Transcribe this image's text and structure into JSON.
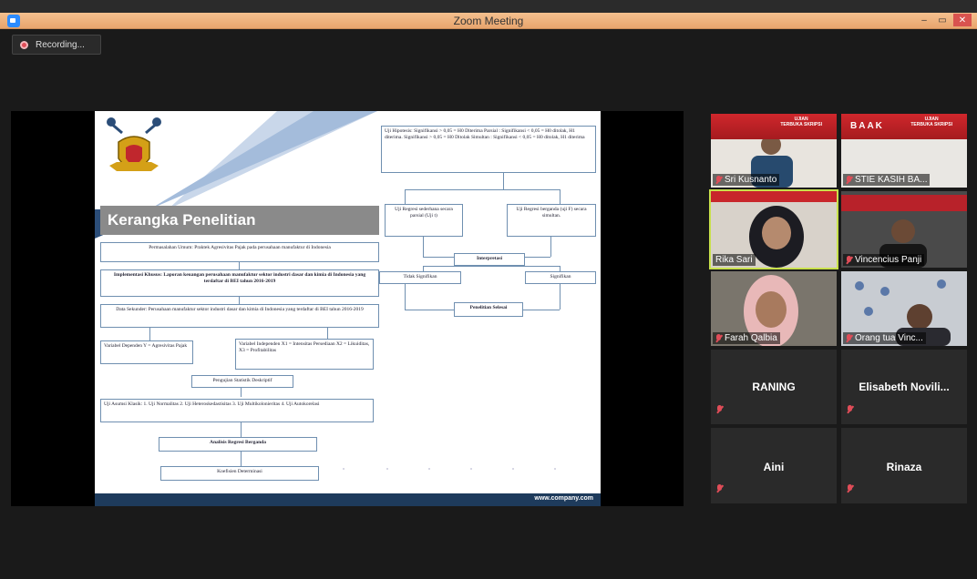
{
  "window": {
    "title": "Zoom Meeting",
    "minimize": "–",
    "maximize": "▭",
    "close": "✕"
  },
  "recording": {
    "label": "Recording..."
  },
  "slide": {
    "title": "Kerangka Penelitian",
    "footer": "www.company.com",
    "boxes": {
      "permasalahan": "Permasalahan Umum: Praktek Agresivitas Pajak pada perusahaan manufaktur di Indonesia",
      "implementasi": "Implementasi Khusus: Laporan keuangan perusahaan manufaktur sektor industri dasar dan kimia di Indonesia yang terdaftar di BEI tahun 2016-2019",
      "data_sekunder": "Data Sekunder: Perusahaan manufaktur sektor industri dasar dan kimia di Indonesia yang terdaftar di BEI tahun 2016-2019",
      "var_dependen": "Variabel Dependen Y = Agresivitas Pajak",
      "var_independen": "Variabel Independen X1 = Intensitas Persediaan X2 = Likuiditas, X3 = Profitabilitas",
      "pengujian": "Pengujian Statistik Deskriptif",
      "uji_asumsi": "Uji Asumsi Klasik: 1. Uji Normalitas 2. Uji Heteroskedastisitas 3. Uji Multikolonieritas 4. Uji Autokorelasi",
      "analisis": "Analisis Regresi Berganda",
      "koefisien": "Koefisien Determinasi",
      "uji_hipotesis": "Uji Hipotesis: Signifikansi > 0,05 = H0 Diterima Parsial : Signifikansi < 0,05 = H0 ditolak, H1 diterima. Signifikansi > 0,05 = H0 Ditolak Simultan : Signifikansi < 0,05 = H0 ditolak, H1 diterima",
      "uji_parsial": "Uji Regresi sederhana secara parsial (Uji t)",
      "uji_simultan": "Uji Regresi berganda (uji F) secara simultan.",
      "interpretasi": "Interpretasi",
      "tidak_signifikan": "Tidak Signifikan",
      "signifikan": "Signifikan",
      "penelitian_selesai": "Penelitian Selesai"
    }
  },
  "participants": [
    {
      "name": "Sri Kusnanto",
      "muted": true,
      "video": true
    },
    {
      "name": "STIE KASIH BA...",
      "muted": true,
      "video": true
    },
    {
      "name": "Rika Sari",
      "muted": false,
      "video": true,
      "active": true
    },
    {
      "name": "Vincencius Panji",
      "muted": true,
      "video": true
    },
    {
      "name": "Farah Qalbia",
      "muted": true,
      "video": true
    },
    {
      "name": "Orang tua Vinc...",
      "muted": true,
      "video": true
    },
    {
      "name": "RANING",
      "muted": true,
      "video": false
    },
    {
      "name": "Elisabeth  Novili...",
      "muted": true,
      "video": false
    },
    {
      "name": "Aini",
      "muted": true,
      "video": false
    },
    {
      "name": "Rinaza",
      "muted": true,
      "video": false
    }
  ],
  "banners": {
    "ujian": "UJIAN",
    "skripsi": "TERBUKA SKRIPSI",
    "baak": "BAAK"
  },
  "colors": {
    "accent": "#2d8cff",
    "active_speaker": "#c8e04b",
    "muted": "#e04d58",
    "banner": "#d0272c"
  }
}
